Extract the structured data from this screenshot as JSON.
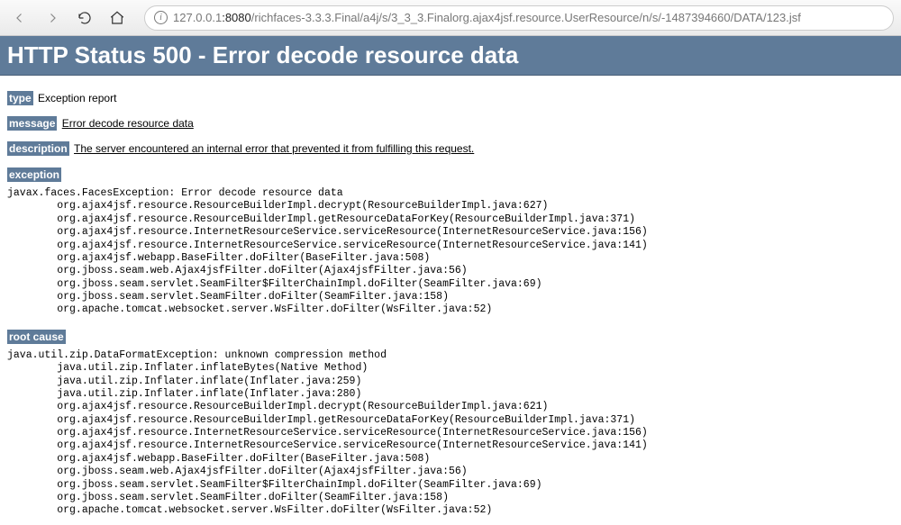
{
  "browser": {
    "url_prefix": "127.0.0.1",
    "url_host": ":8080",
    "url_path": "/richfaces-3.3.3.Final/a4j/s/3_3_3.Finalorg.ajax4jsf.resource.UserResource/n/s/-1487394660/DATA/123.jsf"
  },
  "page": {
    "banner": "HTTP Status 500 - Error decode resource data",
    "type_label": "type",
    "type_value": "Exception report",
    "message_label": "message",
    "message_value": "Error decode resource data",
    "description_label": "description",
    "description_value": "The server encountered an internal error that prevented it from fulfilling this request.",
    "exception_label": "exception",
    "exception_stack": "javax.faces.FacesException: Error decode resource data\n        org.ajax4jsf.resource.ResourceBuilderImpl.decrypt(ResourceBuilderImpl.java:627)\n        org.ajax4jsf.resource.ResourceBuilderImpl.getResourceDataForKey(ResourceBuilderImpl.java:371)\n        org.ajax4jsf.resource.InternetResourceService.serviceResource(InternetResourceService.java:156)\n        org.ajax4jsf.resource.InternetResourceService.serviceResource(InternetResourceService.java:141)\n        org.ajax4jsf.webapp.BaseFilter.doFilter(BaseFilter.java:508)\n        org.jboss.seam.web.Ajax4jsfFilter.doFilter(Ajax4jsfFilter.java:56)\n        org.jboss.seam.servlet.SeamFilter$FilterChainImpl.doFilter(SeamFilter.java:69)\n        org.jboss.seam.servlet.SeamFilter.doFilter(SeamFilter.java:158)\n        org.apache.tomcat.websocket.server.WsFilter.doFilter(WsFilter.java:52)",
    "root_cause_label": "root cause",
    "root_cause_stack": "java.util.zip.DataFormatException: unknown compression method\n        java.util.zip.Inflater.inflateBytes(Native Method)\n        java.util.zip.Inflater.inflate(Inflater.java:259)\n        java.util.zip.Inflater.inflate(Inflater.java:280)\n        org.ajax4jsf.resource.ResourceBuilderImpl.decrypt(ResourceBuilderImpl.java:621)\n        org.ajax4jsf.resource.ResourceBuilderImpl.getResourceDataForKey(ResourceBuilderImpl.java:371)\n        org.ajax4jsf.resource.InternetResourceService.serviceResource(InternetResourceService.java:156)\n        org.ajax4jsf.resource.InternetResourceService.serviceResource(InternetResourceService.java:141)\n        org.ajax4jsf.webapp.BaseFilter.doFilter(BaseFilter.java:508)\n        org.jboss.seam.web.Ajax4jsfFilter.doFilter(Ajax4jsfFilter.java:56)\n        org.jboss.seam.servlet.SeamFilter$FilterChainImpl.doFilter(SeamFilter.java:69)\n        org.jboss.seam.servlet.SeamFilter.doFilter(SeamFilter.java:158)\n        org.apache.tomcat.websocket.server.WsFilter.doFilter(WsFilter.java:52)"
  }
}
